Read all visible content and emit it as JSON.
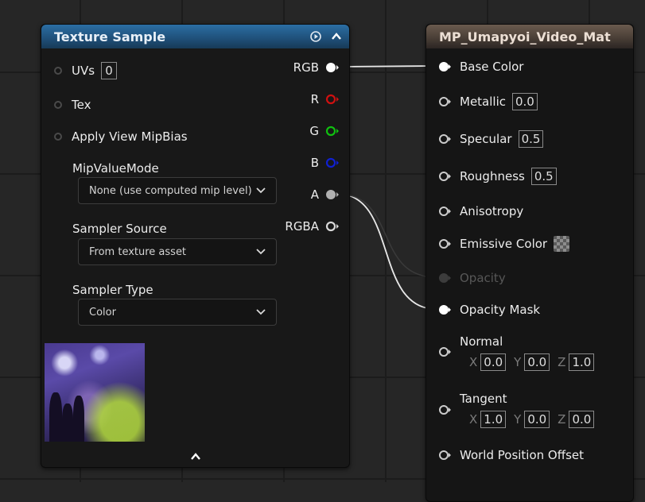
{
  "texture_node": {
    "title": "Texture Sample",
    "inputs": {
      "uvs_label": "UVs",
      "uvs_value": "0",
      "tex_label": "Tex",
      "mipbias_label": "Apply View MipBias"
    },
    "properties": {
      "mip_value_mode_label": "MipValueMode",
      "mip_value_mode_value": "None (use computed mip level)",
      "sampler_source_label": "Sampler Source",
      "sampler_source_value": "From texture asset",
      "sampler_type_label": "Sampler Type",
      "sampler_type_value": "Color"
    },
    "outputs": {
      "rgb": "RGB",
      "r": "R",
      "g": "G",
      "b": "B",
      "a": "A",
      "rgba": "RGBA"
    }
  },
  "material_node": {
    "title": "MP_Umapyoi_Video_Mat",
    "inputs": {
      "base_color": "Base Color",
      "metallic": "Metallic",
      "metallic_value": "0.0",
      "specular": "Specular",
      "specular_value": "0.5",
      "roughness": "Roughness",
      "roughness_value": "0.5",
      "anisotropy": "Anisotropy",
      "emissive_color": "Emissive Color",
      "opacity": "Opacity",
      "opacity_mask": "Opacity Mask",
      "normal": "Normal",
      "normal_x": "0.0",
      "normal_y": "0.0",
      "normal_z": "1.0",
      "tangent": "Tangent",
      "tangent_x": "1.0",
      "tangent_y": "0.0",
      "tangent_z": "0.0",
      "world_position_offset": "World Position Offset"
    },
    "axis_labels": {
      "x": "X",
      "y": "Y",
      "z": "Z"
    }
  },
  "colors": {
    "texture_header": "#1f4f78",
    "material_header": "#4a3f37",
    "pin_r": "#d01010",
    "pin_g": "#10c010",
    "pin_b": "#1020d0",
    "wire": "#e8e8e8"
  },
  "icons": [
    "expand-preview-icon",
    "collapse-node-icon",
    "chevron-down-icon",
    "collapse-preview-icon",
    "checker-swatch-icon"
  ]
}
